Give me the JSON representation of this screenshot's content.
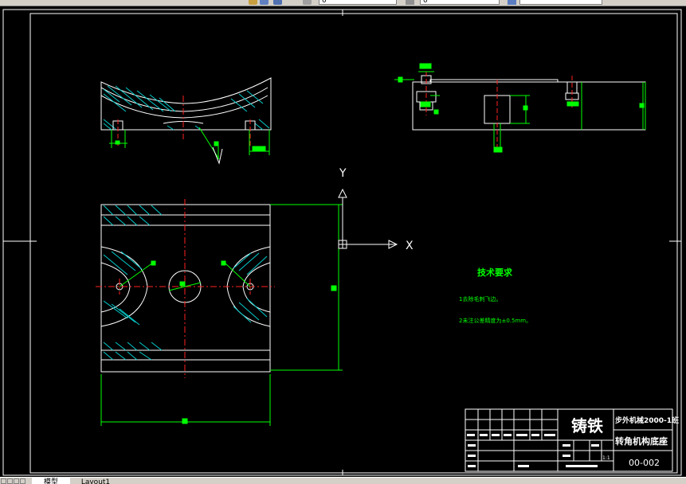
{
  "toolbar": {
    "layer_combo_value": "0",
    "color_combo_value": "0"
  },
  "drawing": {
    "axis_y_label": "Y",
    "axis_x_label": "X",
    "tech_req_title": "技术要求",
    "tech_req_1": "1去除毛刺飞边。",
    "tech_req_2": "2未注公差精度为±0.5mm。",
    "material": "铸铁",
    "school": "步外机械2000-1班",
    "part_name": "转角机构底座",
    "drawing_no": "00-002",
    "scale": "1:1"
  },
  "tabs": {
    "model": "模型",
    "layout1": "Layout1"
  },
  "colors": {
    "line": "#ffffff",
    "dim": "#00ff00",
    "center": "#ff2020",
    "hatch": "#00cccc",
    "background": "#000000"
  }
}
